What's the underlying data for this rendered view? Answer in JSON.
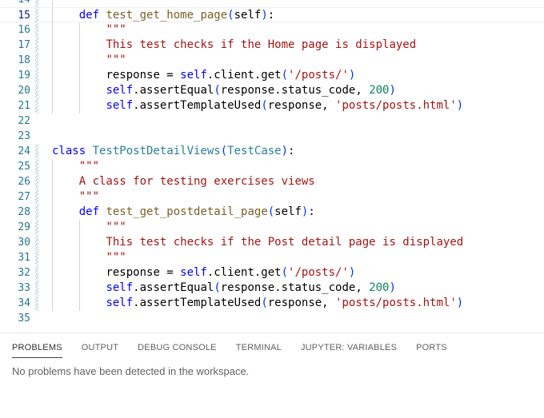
{
  "editor": {
    "lines": [
      {
        "n": "14",
        "tokens": [
          {
            "t": "\"\"\"",
            "c": "str"
          }
        ],
        "indent": 4
      },
      {
        "n": "15",
        "current": true,
        "tokens": [
          {
            "t": "def ",
            "c": "kw"
          },
          {
            "t": "test_get_home_page",
            "c": "fn"
          },
          {
            "t": "(",
            "c": "br"
          },
          {
            "t": "self",
            "c": "p"
          },
          {
            "t": ")",
            "c": "br"
          },
          {
            "t": ":",
            "c": "p"
          }
        ],
        "indent": 4
      },
      {
        "n": "16",
        "tokens": [
          {
            "t": "\"\"\"",
            "c": "str"
          }
        ],
        "indent": 8
      },
      {
        "n": "17",
        "tokens": [
          {
            "t": "This test checks if the Home page is displayed",
            "c": "str"
          }
        ],
        "indent": 8
      },
      {
        "n": "18",
        "tokens": [
          {
            "t": "\"\"\"",
            "c": "str"
          }
        ],
        "indent": 8
      },
      {
        "n": "19",
        "tokens": [
          {
            "t": "response = ",
            "c": "p"
          },
          {
            "t": "self",
            "c": "self"
          },
          {
            "t": ".client.get",
            "c": "p"
          },
          {
            "t": "(",
            "c": "br"
          },
          {
            "t": "'/posts/'",
            "c": "str"
          },
          {
            "t": ")",
            "c": "br"
          }
        ],
        "indent": 8
      },
      {
        "n": "20",
        "tokens": [
          {
            "t": "self",
            "c": "self"
          },
          {
            "t": ".assertEqual",
            "c": "p"
          },
          {
            "t": "(",
            "c": "br"
          },
          {
            "t": "response.status_code, ",
            "c": "p"
          },
          {
            "t": "200",
            "c": "num"
          },
          {
            "t": ")",
            "c": "br"
          }
        ],
        "indent": 8
      },
      {
        "n": "21",
        "tokens": [
          {
            "t": "self",
            "c": "self"
          },
          {
            "t": ".assertTemplateUsed",
            "c": "p"
          },
          {
            "t": "(",
            "c": "br"
          },
          {
            "t": "response, ",
            "c": "p"
          },
          {
            "t": "'posts/posts.html'",
            "c": "str"
          },
          {
            "t": ")",
            "c": "br"
          }
        ],
        "indent": 8
      },
      {
        "n": "22",
        "tokens": [],
        "indent": 0
      },
      {
        "n": "23",
        "tokens": [],
        "indent": 0
      },
      {
        "n": "24",
        "tokens": [
          {
            "t": "class ",
            "c": "kw"
          },
          {
            "t": "TestPostDetailViews",
            "c": "cls"
          },
          {
            "t": "(",
            "c": "br"
          },
          {
            "t": "TestCase",
            "c": "cls"
          },
          {
            "t": ")",
            "c": "br"
          },
          {
            "t": ":",
            "c": "p"
          }
        ],
        "indent": 0
      },
      {
        "n": "25",
        "tokens": [
          {
            "t": "\"\"\"",
            "c": "str"
          }
        ],
        "indent": 4
      },
      {
        "n": "26",
        "tokens": [
          {
            "t": "A class for testing exercises views",
            "c": "str"
          }
        ],
        "indent": 4
      },
      {
        "n": "27",
        "tokens": [
          {
            "t": "\"\"\"",
            "c": "str"
          }
        ],
        "indent": 4
      },
      {
        "n": "28",
        "tokens": [
          {
            "t": "def ",
            "c": "kw"
          },
          {
            "t": "test_get_postdetail_page",
            "c": "fn"
          },
          {
            "t": "(",
            "c": "br"
          },
          {
            "t": "self",
            "c": "p"
          },
          {
            "t": ")",
            "c": "br"
          },
          {
            "t": ":",
            "c": "p"
          }
        ],
        "indent": 4
      },
      {
        "n": "29",
        "tokens": [
          {
            "t": "\"\"\"",
            "c": "str"
          }
        ],
        "indent": 8
      },
      {
        "n": "30",
        "tokens": [
          {
            "t": "This test checks if the Post detail page is displayed",
            "c": "str"
          }
        ],
        "indent": 8
      },
      {
        "n": "31",
        "tokens": [
          {
            "t": "\"\"\"",
            "c": "str"
          }
        ],
        "indent": 8
      },
      {
        "n": "32",
        "tokens": [
          {
            "t": "response = ",
            "c": "p"
          },
          {
            "t": "self",
            "c": "self"
          },
          {
            "t": ".client.get",
            "c": "p"
          },
          {
            "t": "(",
            "c": "br"
          },
          {
            "t": "'/posts/'",
            "c": "str"
          },
          {
            "t": ")",
            "c": "br"
          }
        ],
        "indent": 8
      },
      {
        "n": "33",
        "tokens": [
          {
            "t": "self",
            "c": "self"
          },
          {
            "t": ".assertEqual",
            "c": "p"
          },
          {
            "t": "(",
            "c": "br"
          },
          {
            "t": "response.status_code, ",
            "c": "p"
          },
          {
            "t": "200",
            "c": "num"
          },
          {
            "t": ")",
            "c": "br"
          }
        ],
        "indent": 8
      },
      {
        "n": "34",
        "tokens": [
          {
            "t": "self",
            "c": "self"
          },
          {
            "t": ".assertTemplateUsed",
            "c": "p"
          },
          {
            "t": "(",
            "c": "br"
          },
          {
            "t": "response, ",
            "c": "p"
          },
          {
            "t": "'posts/posts.html'",
            "c": "str"
          },
          {
            "t": ")",
            "c": "br"
          }
        ],
        "indent": 8
      },
      {
        "n": "35",
        "tokens": [],
        "indent": 0
      }
    ]
  },
  "panel": {
    "tabs": [
      {
        "label": "PROBLEMS",
        "active": true
      },
      {
        "label": "OUTPUT",
        "active": false
      },
      {
        "label": "DEBUG CONSOLE",
        "active": false
      },
      {
        "label": "TERMINAL",
        "active": false
      },
      {
        "label": "JUPYTER: VARIABLES",
        "active": false
      },
      {
        "label": "PORTS",
        "active": false
      }
    ],
    "message": "No problems have been detected in the workspace."
  },
  "colors": {
    "keyword": "#0000ff",
    "function": "#795e26",
    "class": "#267f99",
    "string": "#a31515",
    "number": "#098658",
    "line_number": "#237893"
  }
}
